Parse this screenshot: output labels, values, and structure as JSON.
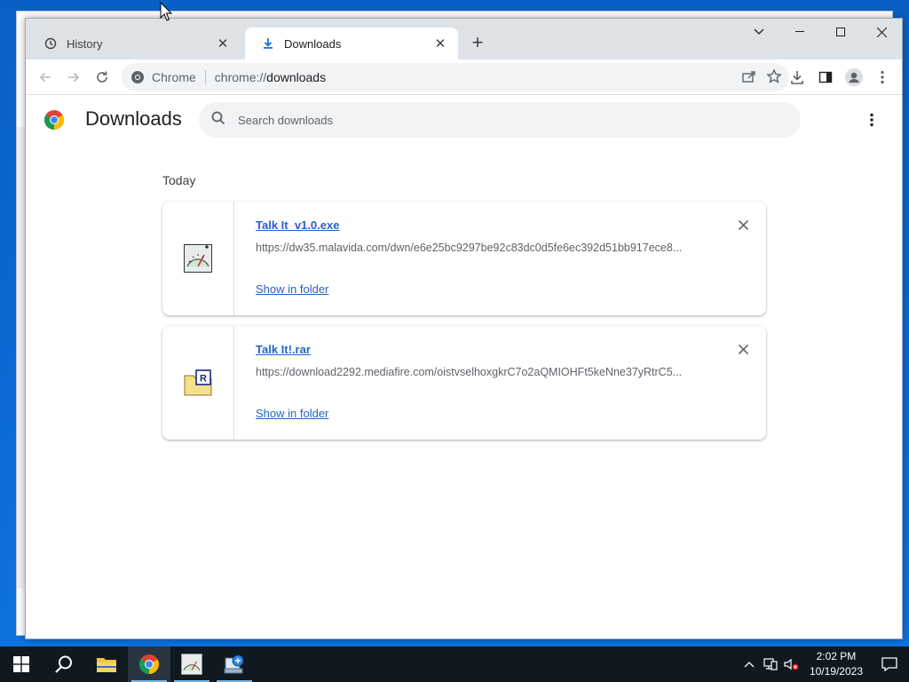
{
  "tabs": [
    {
      "label": "History",
      "icon": "history-icon"
    },
    {
      "label": "Downloads",
      "icon": "download-icon"
    }
  ],
  "omnibox": {
    "chip_label": "Chrome",
    "url_prefix": "chrome://",
    "url_host": "downloads"
  },
  "page": {
    "title": "Downloads",
    "search_placeholder": "Search downloads",
    "section_label": "Today"
  },
  "downloads": [
    {
      "filename": "Talk It_v1.0.exe",
      "url": "https://dw35.malavida.com/dwn/e6e25bc9297be92c83dc0d5fe6ec392d51bb917ece8...",
      "action": "Show in folder",
      "icon": "talkit-exe-icon"
    },
    {
      "filename": "Talk It!.rar",
      "url": "https://download2292.mediafire.com/oistvselhoxgkrC7o2aQMIOHFt5keNne37yRtrC5...",
      "action": "Show in folder",
      "icon": "rar-archive-icon"
    }
  ],
  "taskbar": {
    "time": "2:02 PM",
    "date": "10/19/2023"
  },
  "colors": {
    "link": "#1f67c4",
    "tabstrip": "#dee3e8",
    "taskbar": "#101820",
    "desktop": "#0b6ad6"
  }
}
